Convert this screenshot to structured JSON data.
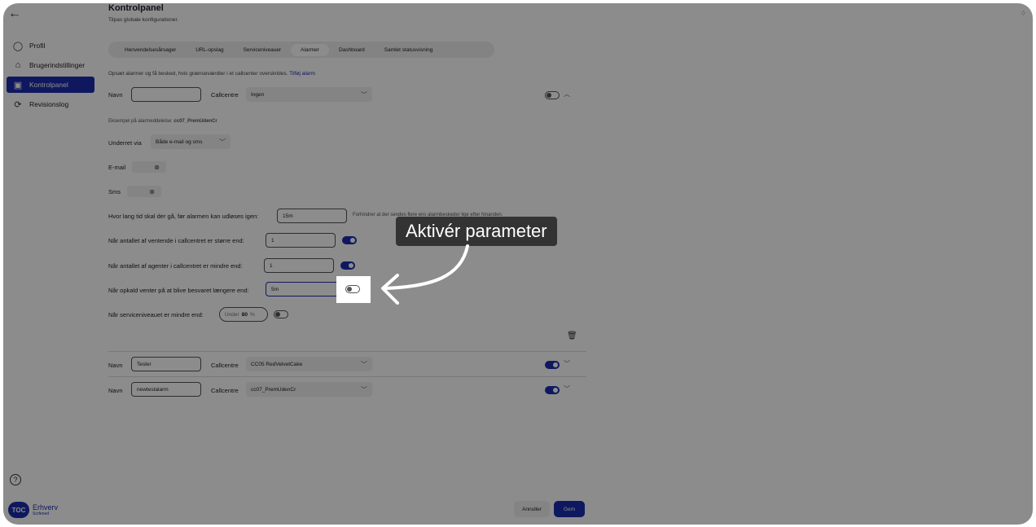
{
  "app": {
    "title": "Kontrolpanel",
    "subtitle": "Tilpas globale konfigurationer."
  },
  "sidebar": {
    "items": [
      {
        "label": "Profil",
        "icon": "user-icon"
      },
      {
        "label": "Brugerindstillinger",
        "icon": "home-icon"
      },
      {
        "label": "Kontrolpanel",
        "icon": "panel-icon",
        "active": true
      },
      {
        "label": "Revisionslog",
        "icon": "refresh-icon"
      }
    ],
    "logo_badge": "TOC",
    "logo_text": "Erhverv",
    "logo_sub": "Scrfened"
  },
  "tabs": [
    {
      "label": "Henvendelsesårsager"
    },
    {
      "label": "URL-opslag"
    },
    {
      "label": "Serviceniveauer"
    },
    {
      "label": "Alarmer",
      "active": true
    },
    {
      "label": "Dashboard"
    },
    {
      "label": "Samlet statusvisning"
    }
  ],
  "description": {
    "text": "Opsæt alarmer og få besked, hvis grænseværdier i et callcenter overskrides.",
    "link": "Tilføj alarm"
  },
  "alarm1": {
    "name_label": "Navn",
    "name_value": "",
    "callcentre_label": "Callcentre",
    "callcentre_value": "Ingen",
    "example_prefix": "Eksempel på alarmeddelelse:",
    "example_value": "cc07_PremUdenCr",
    "notify_label": "Underret via",
    "notify_value": "Både e-mail og sms",
    "email_label": "E-mail",
    "sms_label": "Sms",
    "cooldown_label": "Hvor lang tid skal der gå, før alarmen kan udløses igen:",
    "cooldown_value": "15m",
    "cooldown_hint": "Forhindrer at der sendes flere ens alarmbeskeder lige efter hinanden.",
    "waiting_label": "Når antallet af ventende i callcentret er større end:",
    "waiting_value": "1",
    "agents_label": "Når antallet af agenter i callcentret er mindre end:",
    "agents_value": "1",
    "answer_label": "Når opkald venter på at blive besvaret længere end:",
    "answer_value": "5m",
    "service_label": "Når serviceniveauet er mindre end:",
    "service_prefix": "Under",
    "service_value": "80",
    "service_unit": "%"
  },
  "alarm2": {
    "name_label": "Navn",
    "name_value": "Tester",
    "callcentre_label": "Callcentre",
    "callcentre_value": "CC05 RedVelvetCake"
  },
  "alarm3": {
    "name_label": "Navn",
    "name_value": "newtestalarm",
    "callcentre_label": "Callcentre",
    "callcentre_value": "cc07_PremUdenCr"
  },
  "footer": {
    "cancel": "Annuller",
    "save": "Gem"
  },
  "callout": {
    "text": "Aktivér parameter"
  },
  "colors": {
    "accent": "#1c2dae",
    "overlay": "rgba(0,0,0,0.45)"
  }
}
